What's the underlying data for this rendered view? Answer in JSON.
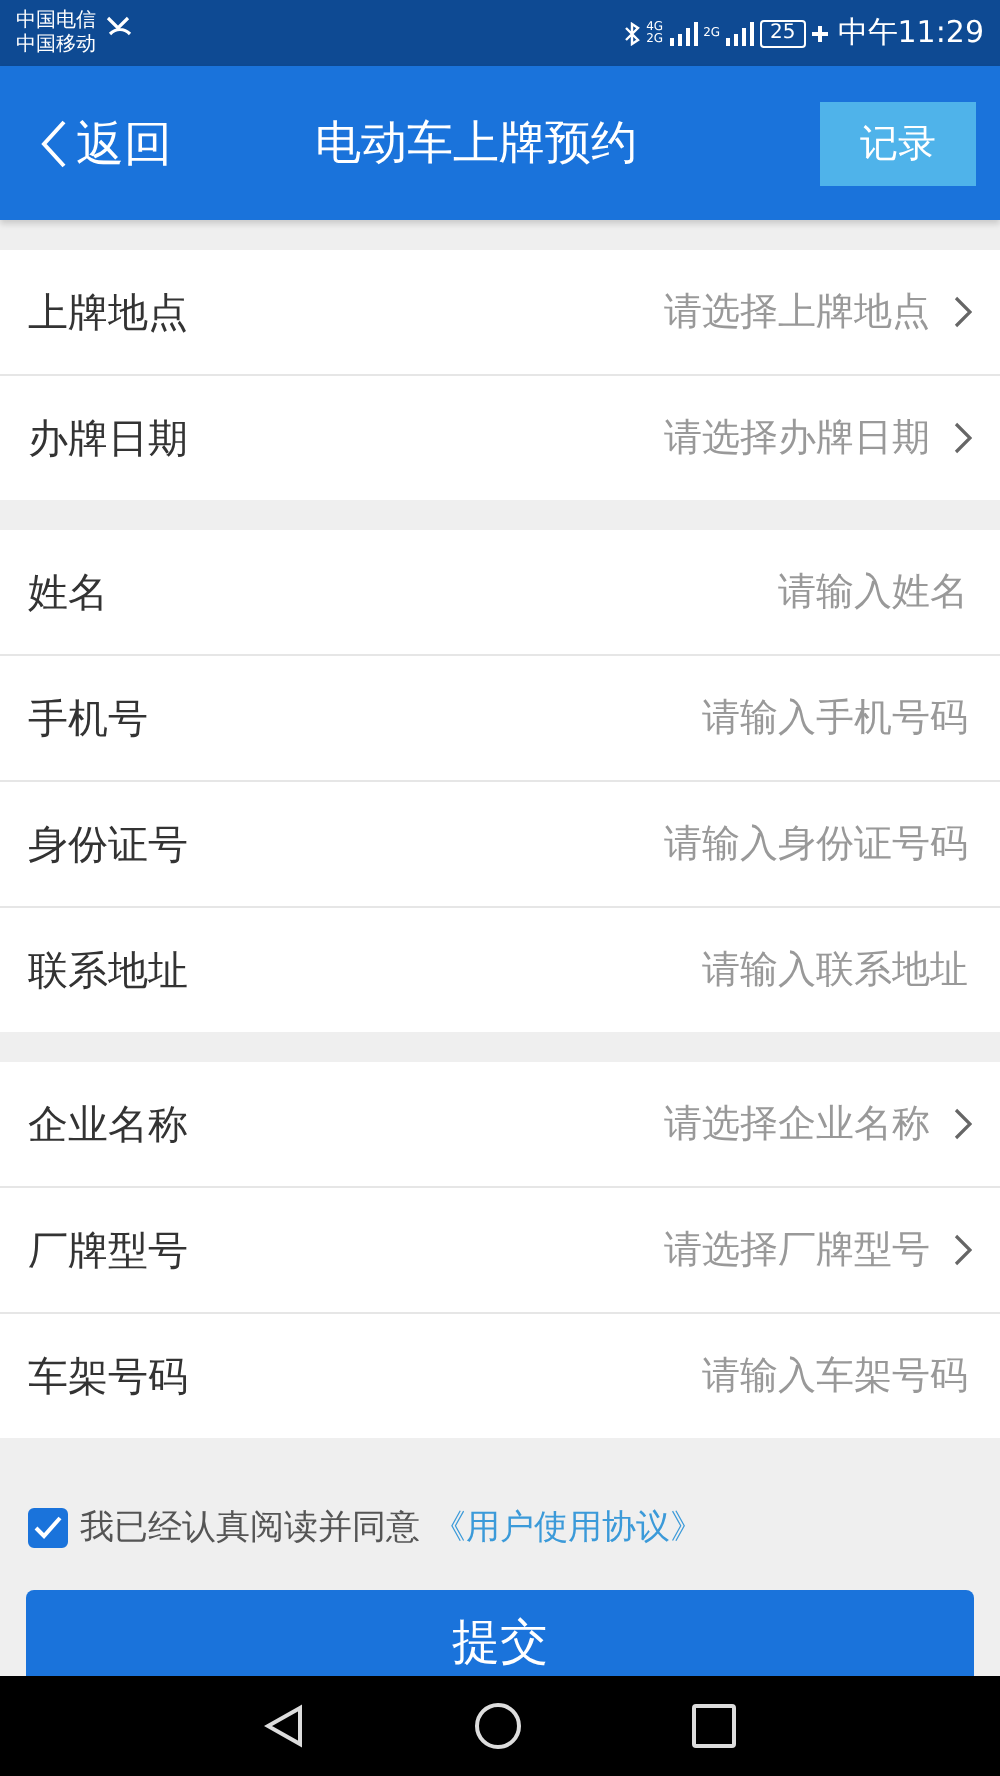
{
  "status_bar": {
    "carriers": [
      "中国电信",
      "中国移动"
    ],
    "network_labels": [
      "4G",
      "2G",
      "2G"
    ],
    "battery": "25",
    "time": "中午11:29"
  },
  "header": {
    "back": "返回",
    "title": "电动车上牌预约",
    "action": "记录"
  },
  "sections": [
    {
      "rows": [
        {
          "kind": "select",
          "label": "上牌地点",
          "placeholder": "请选择上牌地点"
        },
        {
          "kind": "select",
          "label": "办牌日期",
          "placeholder": "请选择办牌日期"
        }
      ]
    },
    {
      "rows": [
        {
          "kind": "input",
          "label": "姓名",
          "placeholder": "请输入姓名"
        },
        {
          "kind": "input",
          "label": "手机号",
          "placeholder": "请输入手机号码"
        },
        {
          "kind": "input",
          "label": "身份证号",
          "placeholder": "请输入身份证号码"
        },
        {
          "kind": "input",
          "label": "联系地址",
          "placeholder": "请输入联系地址"
        }
      ]
    },
    {
      "rows": [
        {
          "kind": "select",
          "label": "企业名称",
          "placeholder": "请选择企业名称"
        },
        {
          "kind": "select",
          "label": "厂牌型号",
          "placeholder": "请选择厂牌型号"
        },
        {
          "kind": "input",
          "label": "车架号码",
          "placeholder": "请输入车架号码"
        }
      ]
    }
  ],
  "agreement": {
    "checked": true,
    "text": "我已经认真阅读并同意",
    "link": "《用户使用协议》"
  },
  "submit": "提交"
}
